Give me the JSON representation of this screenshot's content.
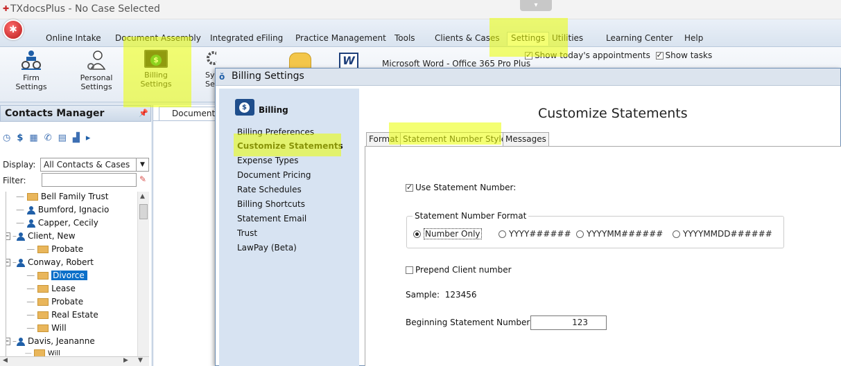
{
  "window": {
    "title": "TXdocsPlus - No Case Selected"
  },
  "tabs": {
    "online_intake": "Online Intake",
    "document_assembly": "Document Assembly",
    "integrated_efiling": "Integrated eFiling",
    "practice_management": "Practice Management",
    "tools": "Tools",
    "clients_cases": "Clients & Cases",
    "settings": "Settings",
    "utilities": "Utilities",
    "learning_center": "Learning Center",
    "help": "Help"
  },
  "ribbon": {
    "firm_settings": "Firm\nSettings",
    "personal_settings": "Personal\nSettings",
    "billing_settings": "Billing\nSettings",
    "sys_label_fragment": "Sy\nSe",
    "word_label": "Microsoft Word - Office 365 Pro Plus",
    "show_appointments": "Show today's appointments",
    "show_tasks": "Show tasks"
  },
  "contacts": {
    "title": "Contacts Manager",
    "display_label": "Display:",
    "display_value": "All Contacts & Cases",
    "filter_label": "Filter:",
    "filter_value": "",
    "tree": [
      {
        "type": "case",
        "label": "Bell Family Trust"
      },
      {
        "type": "contact",
        "label": "Bumford, Ignacio"
      },
      {
        "type": "contact",
        "label": "Capper, Cecily"
      },
      {
        "type": "contact",
        "label": "Client, New"
      },
      {
        "type": "case",
        "label": "Probate"
      },
      {
        "type": "contact",
        "label": "Conway, Robert"
      },
      {
        "type": "case",
        "label": "Divorce"
      },
      {
        "type": "case",
        "label": "Lease"
      },
      {
        "type": "case",
        "label": "Probate"
      },
      {
        "type": "case",
        "label": "Real Estate"
      },
      {
        "type": "case",
        "label": "Will"
      },
      {
        "type": "contact",
        "label": "Davis, Jeananne"
      },
      {
        "type": "case",
        "label": "Will"
      }
    ]
  },
  "doc_tab": "Document",
  "dialog": {
    "title": "Billing Settings",
    "nav_title": "Billing",
    "nav_items": [
      "Billing Preferences",
      "Customize Statements",
      "Expense Types",
      "Document Pricing",
      "Rate Schedules",
      "Billing Shortcuts",
      "Statement Email",
      "Trust",
      "LawPay (Beta)"
    ],
    "active_nav": "Customize Statements",
    "heading": "Customize Statements",
    "tabs": [
      "Format",
      "Statement Number Style",
      "Messages"
    ],
    "active_tab": "Statement Number Style",
    "use_statement_number": {
      "label": "Use Statement Number:",
      "checked": true
    },
    "format_group": {
      "legend": "Statement Number Format",
      "options": [
        "Number Only",
        "YYYY######",
        "YYYYMM######",
        "YYYYMMDD######"
      ],
      "selected": "Number Only"
    },
    "prepend_client": {
      "label": "Prepend Client number",
      "checked": false
    },
    "sample_label": "Sample:",
    "sample_value": "123456",
    "beginning_label": "Beginning Statement Number:",
    "beginning_value": "123"
  },
  "colors": {
    "highlight": "#ebff00",
    "selection": "#0b6fc9",
    "nav_panel": "#d7e3f2"
  }
}
